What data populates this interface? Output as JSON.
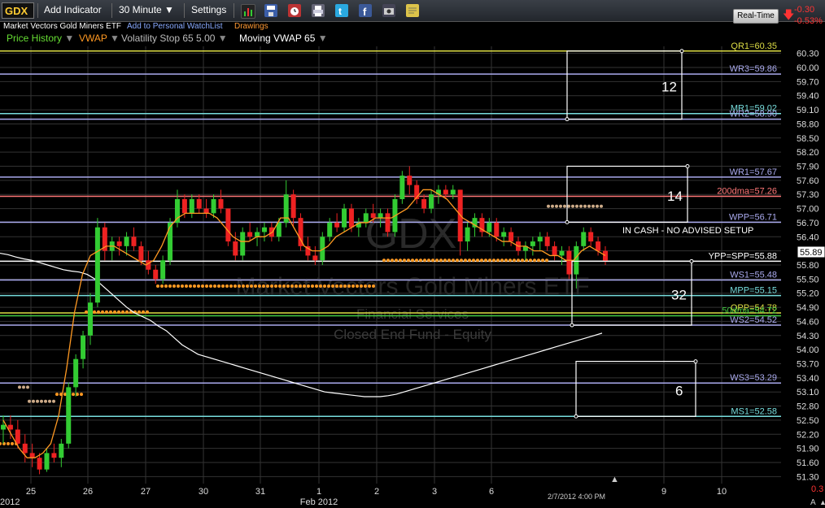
{
  "toolbar": {
    "symbol": "GDX",
    "add_indicator": "Add Indicator",
    "timeframe": "30 Minute",
    "settings": "Settings",
    "icons": [
      "bar-chart-icon",
      "save-icon",
      "alarm-clock-icon",
      "print-icon",
      "twitter-icon",
      "facebook-icon",
      "camera-icon",
      "note-icon"
    ],
    "realtime": "Real-Time",
    "change": "-0.30",
    "change_pct": "-0.53%"
  },
  "header": {
    "name": "Market Vectors Gold Miners ETF",
    "watchlist": "Add to Personal WatchList",
    "drawings": "Drawings"
  },
  "studies": [
    {
      "label": "Price History",
      "color": "#66dd33"
    },
    {
      "label": "VWAP",
      "color": "#ff9922"
    },
    {
      "label": "Volatility Stop 65 5.00",
      "color": "#bbbbbb"
    },
    {
      "label": "Moving VWAP 65",
      "color": "#ffffff"
    }
  ],
  "watermark": {
    "symbol": "GDX",
    "name": "Market Vectors Gold Miners ETF",
    "sector": "Financial Services",
    "category": "Closed End Fund - Equity"
  },
  "colors": {
    "up": "#33cc33",
    "down": "#ee2222",
    "vwap": "#ff9922",
    "moving_vwap": "#ffffff",
    "grid": "#333333"
  },
  "chart_data": {
    "type": "candlestick",
    "y_range": [
      51.15,
      60.45
    ],
    "y_ticks": [
      "60.30",
      "60.00",
      "59.70",
      "59.40",
      "59.10",
      "58.80",
      "58.50",
      "58.20",
      "57.90",
      "57.60",
      "57.30",
      "57.00",
      "56.70",
      "56.40",
      "56.10",
      "55.80",
      "55.50",
      "55.20",
      "54.90",
      "54.60",
      "54.30",
      "54.00",
      "53.70",
      "53.40",
      "53.10",
      "52.80",
      "52.50",
      "52.20",
      "51.90",
      "51.60",
      "51.30"
    ],
    "x_labels": [
      "25",
      "26",
      "27",
      "30",
      "31",
      "1",
      "2",
      "3",
      "6",
      "9",
      "10"
    ],
    "x_period_labels": [
      "2012",
      "Feb 2012"
    ],
    "last_bar_time": "2/7/2012 4:00 PM",
    "last_price": "55.89",
    "bottom_right_value": "0.3",
    "bottom_right_marker": "A",
    "levels": [
      {
        "label": "QR1=60.35",
        "value": 60.35,
        "color": "#dddd44"
      },
      {
        "label": "WR3=59.86",
        "value": 59.86,
        "color": "#aaaaee"
      },
      {
        "label": "MR1=59.02",
        "value": 59.02,
        "color": "#77dddd"
      },
      {
        "label": "WR2=58.90",
        "value": 58.9,
        "color": "#aaaaee"
      },
      {
        "label": "WR1=57.67",
        "value": 57.67,
        "color": "#aaaaee"
      },
      {
        "label": "200dma=57.26",
        "value": 57.26,
        "color": "#ff7777"
      },
      {
        "label": "WPP=56.71",
        "value": 56.71,
        "color": "#aaaaee"
      },
      {
        "label": "YPP=SPP=55.88",
        "value": 55.88,
        "color": "#ffffff"
      },
      {
        "label": "WS1=55.48",
        "value": 55.48,
        "color": "#aaaaee"
      },
      {
        "label": "MPP=55.15",
        "value": 55.15,
        "color": "#77dddd"
      },
      {
        "label": "QPP=54.78",
        "value": 54.78,
        "color": "#dddd44"
      },
      {
        "label": "50dma=54.72",
        "value": 54.72,
        "color": "#44cc44"
      },
      {
        "label": "WS2=54.52",
        "value": 54.52,
        "color": "#aaaaee"
      },
      {
        "label": "WS3=53.29",
        "value": 53.29,
        "color": "#aaaaee"
      },
      {
        "label": "MS1=52.58",
        "value": 52.58,
        "color": "#77dddd"
      }
    ],
    "annotation": "IN CASH - NO ADVISED SETUP",
    "boxes": [
      {
        "label": "12",
        "top": 60.35,
        "bottom": 58.9
      },
      {
        "label": "14",
        "top": 57.9,
        "bottom": 56.71
      },
      {
        "label": "32",
        "top": 55.88,
        "bottom": 54.52
      },
      {
        "label": "6",
        "top": 53.75,
        "bottom": 52.58
      }
    ],
    "candles": [
      [
        52.3,
        52.6,
        52.0,
        52.4
      ],
      [
        52.4,
        52.6,
        52.1,
        52.3
      ],
      [
        52.3,
        52.5,
        51.9,
        52.0
      ],
      [
        52.0,
        52.2,
        51.6,
        51.8
      ],
      [
        51.8,
        52.0,
        51.5,
        51.7
      ],
      [
        51.7,
        51.8,
        51.35,
        51.45
      ],
      [
        51.45,
        51.9,
        51.4,
        51.8
      ],
      [
        51.8,
        52.0,
        51.6,
        51.7
      ],
      [
        51.7,
        52.1,
        51.5,
        52.0
      ],
      [
        52.0,
        53.3,
        51.9,
        53.2
      ],
      [
        53.2,
        53.9,
        53.0,
        53.8
      ],
      [
        53.8,
        54.4,
        53.6,
        54.3
      ],
      [
        54.3,
        55.2,
        54.1,
        55.0
      ],
      [
        55.0,
        56.8,
        54.9,
        56.6
      ],
      [
        56.6,
        56.7,
        55.9,
        56.1
      ],
      [
        56.1,
        56.4,
        55.9,
        56.3
      ],
      [
        56.3,
        56.4,
        56.0,
        56.2
      ],
      [
        56.2,
        56.5,
        56.0,
        56.4
      ],
      [
        56.4,
        56.6,
        56.1,
        56.2
      ],
      [
        56.2,
        56.3,
        55.8,
        55.9
      ],
      [
        55.9,
        56.1,
        55.6,
        55.7
      ],
      [
        55.7,
        55.8,
        55.4,
        55.5
      ],
      [
        55.5,
        56.0,
        55.4,
        55.9
      ],
      [
        55.9,
        56.8,
        55.8,
        56.7
      ],
      [
        56.7,
        57.4,
        56.6,
        57.2
      ],
      [
        57.2,
        57.3,
        56.8,
        56.9
      ],
      [
        56.9,
        57.3,
        56.8,
        57.2
      ],
      [
        57.2,
        57.3,
        56.9,
        57.0
      ],
      [
        57.0,
        57.2,
        56.8,
        56.9
      ],
      [
        56.9,
        57.3,
        56.8,
        57.2
      ],
      [
        57.2,
        57.4,
        56.9,
        57.0
      ],
      [
        57.0,
        57.0,
        56.2,
        56.3
      ],
      [
        56.3,
        56.5,
        55.9,
        56.0
      ],
      [
        56.0,
        56.6,
        55.9,
        56.5
      ],
      [
        56.5,
        56.7,
        56.3,
        56.4
      ],
      [
        56.4,
        56.6,
        56.2,
        56.5
      ],
      [
        56.5,
        56.7,
        56.3,
        56.6
      ],
      [
        56.6,
        56.7,
        56.3,
        56.4
      ],
      [
        56.4,
        56.8,
        56.3,
        56.7
      ],
      [
        56.7,
        57.6,
        56.6,
        57.3
      ],
      [
        57.3,
        57.4,
        56.6,
        56.8
      ],
      [
        56.8,
        56.9,
        56.1,
        56.2
      ],
      [
        56.2,
        56.4,
        55.9,
        56.0
      ],
      [
        56.0,
        56.2,
        55.8,
        55.9
      ],
      [
        55.9,
        56.5,
        55.8,
        56.4
      ],
      [
        56.4,
        56.8,
        56.3,
        56.7
      ],
      [
        56.7,
        56.9,
        56.5,
        56.6
      ],
      [
        56.6,
        57.1,
        56.5,
        57.0
      ],
      [
        57.0,
        57.1,
        56.5,
        56.6
      ],
      [
        56.6,
        56.8,
        56.4,
        56.7
      ],
      [
        56.7,
        57.0,
        56.6,
        56.9
      ],
      [
        56.9,
        57.1,
        56.7,
        56.8
      ],
      [
        56.8,
        57.0,
        56.6,
        56.9
      ],
      [
        56.9,
        57.0,
        56.4,
        56.5
      ],
      [
        56.5,
        57.3,
        56.4,
        57.2
      ],
      [
        57.2,
        57.8,
        57.1,
        57.7
      ],
      [
        57.7,
        57.9,
        57.3,
        57.5
      ],
      [
        57.5,
        57.6,
        57.1,
        57.2
      ],
      [
        57.2,
        57.3,
        56.9,
        57.0
      ],
      [
        57.0,
        57.4,
        56.9,
        57.3
      ],
      [
        57.3,
        57.5,
        57.1,
        57.4
      ],
      [
        57.4,
        57.5,
        57.2,
        57.3
      ],
      [
        57.3,
        57.5,
        57.2,
        57.4
      ],
      [
        57.4,
        57.4,
        56.0,
        56.3
      ],
      [
        56.3,
        56.7,
        56.1,
        56.6
      ],
      [
        56.6,
        56.9,
        56.4,
        56.8
      ],
      [
        56.8,
        56.9,
        56.4,
        56.5
      ],
      [
        56.5,
        56.8,
        56.4,
        56.7
      ],
      [
        56.7,
        56.8,
        56.3,
        56.4
      ],
      [
        56.4,
        56.6,
        56.2,
        56.5
      ],
      [
        56.5,
        56.6,
        56.2,
        56.3
      ],
      [
        56.3,
        56.4,
        56.0,
        56.1
      ],
      [
        56.1,
        56.3,
        55.9,
        56.2
      ],
      [
        56.2,
        56.4,
        56.0,
        56.3
      ],
      [
        56.3,
        56.5,
        56.1,
        56.4
      ],
      [
        56.4,
        56.5,
        56.1,
        56.2
      ],
      [
        56.2,
        56.3,
        55.9,
        56.0
      ],
      [
        56.0,
        56.2,
        55.8,
        56.1
      ],
      [
        56.1,
        56.2,
        55.5,
        55.6
      ],
      [
        55.6,
        56.3,
        55.3,
        56.2
      ],
      [
        56.2,
        56.6,
        56.1,
        56.5
      ],
      [
        56.5,
        56.6,
        56.2,
        56.3
      ],
      [
        56.3,
        56.4,
        56.0,
        56.1
      ],
      [
        56.1,
        56.2,
        55.8,
        55.89
      ]
    ],
    "vwap": [
      52.5,
      52.2,
      51.9,
      51.7,
      51.7,
      51.8,
      52.0,
      52.6,
      53.6,
      54.8,
      55.6,
      56.0,
      56.1,
      56.2,
      56.2,
      56.1,
      56.0,
      55.9,
      55.8,
      55.9,
      56.2,
      56.6,
      56.8,
      56.9,
      56.9,
      56.9,
      56.9,
      56.8,
      56.6,
      56.4,
      56.3,
      56.3,
      56.4,
      56.4,
      56.5,
      56.8,
      56.8,
      56.5,
      56.2,
      56.1,
      56.1,
      56.2,
      56.4,
      56.5,
      56.6,
      56.7,
      56.7,
      56.8,
      56.8,
      56.8,
      56.9,
      57.0,
      57.2,
      57.4,
      57.4,
      57.3,
      57.2,
      57.0,
      56.8,
      56.7,
      56.6,
      56.5,
      56.4,
      56.3,
      56.3,
      56.2,
      56.2,
      56.1,
      56.1,
      56.0,
      56.0,
      55.9,
      55.9,
      56.1,
      56.2,
      56.1,
      56.0
    ],
    "moving_vwap": [
      56.05,
      56.02,
      55.97,
      55.93,
      55.9,
      55.85,
      55.8,
      55.75,
      55.7,
      55.67,
      55.65,
      55.6,
      55.5,
      55.35,
      55.2,
      55.05,
      54.9,
      54.78,
      54.7,
      54.62,
      54.5,
      54.4,
      54.25,
      54.1,
      54.0,
      53.9,
      53.85,
      53.8,
      53.75,
      53.7,
      53.65,
      53.6,
      53.55,
      53.5,
      53.45,
      53.4,
      53.35,
      53.3,
      53.25,
      53.2,
      53.15,
      53.1,
      53.08,
      53.06,
      53.04,
      53.02,
      53.0,
      53.0,
      53.0,
      53.02,
      53.05,
      53.1,
      53.15,
      53.2,
      53.25,
      53.3,
      53.35,
      53.4,
      53.45,
      53.5,
      53.55,
      53.6,
      53.65,
      53.7,
      53.75,
      53.8,
      53.85,
      53.9,
      53.95,
      54.0,
      54.05,
      54.1,
      54.15,
      54.2,
      54.25,
      54.3,
      54.35
    ]
  }
}
